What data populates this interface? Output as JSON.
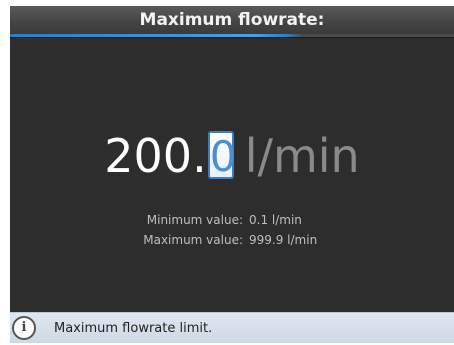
{
  "header": {
    "title": "Maximum flowrate:"
  },
  "value": {
    "integer_part": "200.",
    "active_digit": "0",
    "unit": "l/min"
  },
  "limits": {
    "min_label": "Minimum value:",
    "min_value": "0.1 l/min",
    "max_label": "Maximum value:",
    "max_value": "999.9 l/min"
  },
  "footer": {
    "icon": "info-icon",
    "message": "Maximum flowrate limit."
  },
  "colors": {
    "accent": "#3a7fc6",
    "background": "#2d2d2d"
  }
}
